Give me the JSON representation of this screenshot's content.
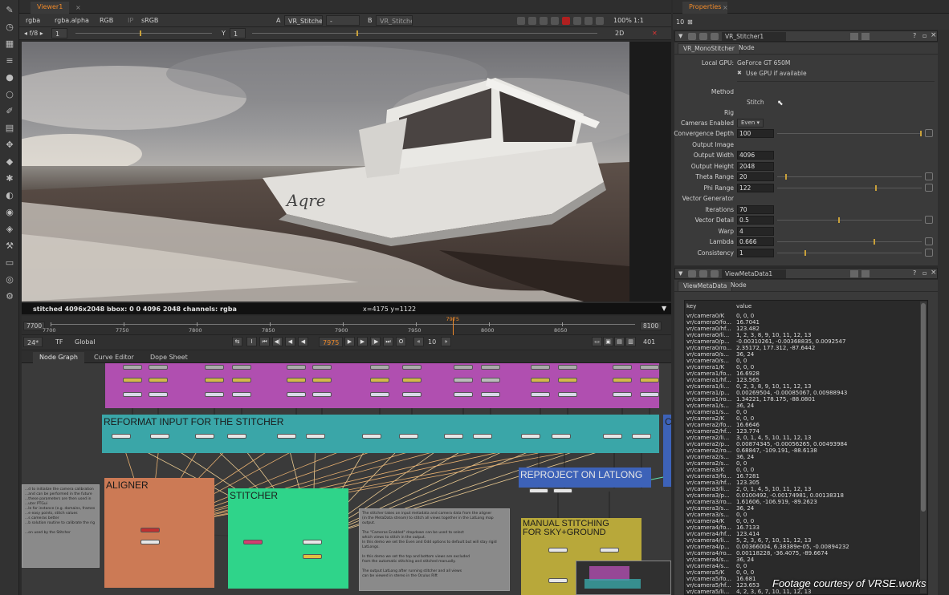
{
  "toolbar": {
    "tools": [
      "pen-icon",
      "clock-icon",
      "grid-icon",
      "lines-icon",
      "sphere-icon",
      "circle-icon",
      "brush-icon",
      "layers-icon",
      "move-icon",
      "cube-icon",
      "star-icon",
      "d-icon",
      "eye-icon",
      "tag-icon",
      "wrench-icon",
      "box-icon",
      "globe-icon",
      "settings-icon"
    ]
  },
  "viewer": {
    "tab_label": "Viewer1",
    "channels": "rgba",
    "alpha": "rgba.alpha",
    "colorspace": "RGB",
    "ip": "IP",
    "lut": "sRGB",
    "input_a_letter": "A",
    "input_a": "VR_Stitcher",
    "input_mid": "-",
    "input_b_letter": "B",
    "input_b": "VR_Stitcher",
    "zoom": "100%",
    "ratio": "1:1",
    "fstop": "f/8",
    "gain_value": "1",
    "gamma_label": "Y",
    "gamma_value": "1",
    "view_mode": "2D",
    "status_info": "stitched 4096x2048  bbox: 0 0 4096 2048 channels: rgba",
    "coords": "x=4175 y=1122"
  },
  "timeline": {
    "start": "7700",
    "end": "8100",
    "ticks": [
      "7700",
      "7750",
      "7800",
      "7850",
      "7900",
      "7950",
      "8000",
      "8050"
    ],
    "current": "7975",
    "current_fraction": 0.6875,
    "fps": "24*",
    "tf": "TF",
    "scope": "Global",
    "frame_field": "7975",
    "step": "10",
    "end_field": "401"
  },
  "node_graph_tabs": [
    "Node Graph",
    "Curve Editor",
    "Dope Sheet"
  ],
  "backdrops": {
    "reformat": "REFORMAT INPUT FOR THE STITCHER",
    "aligner": "ALIGNER",
    "stitcher": "STITCHER",
    "reproject": "REPROJECT ON LATLONG",
    "manual": "MANUAL STITCHING\nFOR SKY+GROUND",
    "edge": "C"
  },
  "sticky_left": "...d to initialize the camera calibration\n...and can be performed in the future\n...these parameters are then used in\n...uter PTGui\n...le for instance (e.g. domains, frames\n...e easy points, stitch values\n...s cameras better\n...b solution routine to calibrate the rig\n\n...on used by the Stitcher",
  "sticky_mid": "The stitcher takes an input metadata and camera data from the aligner\n(in the MetaData stream) to stitch all views together in the LatLong map output.\n\nThe \"Cameras Enabled\" dropdown can be used to select\nwhich views to stitch in the output.\nIn this demo we set the Even and Odd options to default but will stay rigid\nLatLongs.\n\nIn this demo we set the top and bottom views are excluded\nfrom the automatic stitching and stitched manually.\n\nThe output LatLong after running stitcher and all views\ncan be viewed in stereo in the Oculus Rift",
  "properties": {
    "tab_label": "Properties",
    "count": "10",
    "stitcher_panel": {
      "name": "VR_Stitcher1",
      "tabs": [
        "VR_MonoStitcher",
        "Node"
      ],
      "local_gpu_label": "Local GPU:",
      "local_gpu_value": "GeForce GT 650M",
      "use_gpu": "Use GPU if available",
      "method_label": "Method",
      "stitch_button": "Stitch",
      "rig_label": "Rig",
      "cameras_enabled_label": "Cameras Enabled",
      "cameras_enabled_value": "Even",
      "convergence_label": "Convergence Depth",
      "convergence_value": "100",
      "output_image_label": "Output Image",
      "output_width_label": "Output Width",
      "output_width_value": "4096",
      "output_height_label": "Output Height",
      "output_height_value": "2048",
      "theta_label": "Theta Range",
      "theta_value": "20",
      "phi_label": "Phi Range",
      "phi_value": "122",
      "vector_gen_label": "Vector Generator",
      "iterations_label": "Iterations",
      "iterations_value": "70",
      "vector_detail_label": "Vector Detail",
      "vector_detail_value": "0.5",
      "warp_label": "Warp",
      "warp_value": "4",
      "lambda_label": "Lambda",
      "lambda_value": "0.666",
      "consistency_label": "Consistency",
      "consistency_value": "1"
    },
    "meta_panel": {
      "name": "ViewMetaData1",
      "tabs": [
        "ViewMetaData",
        "Node"
      ],
      "col_key": "key",
      "col_value": "value",
      "rows": [
        [
          "vr/camera0/K",
          "0, 0, 0"
        ],
        [
          "vr/camera0/fo...",
          "16.7041"
        ],
        [
          "vr/camera0/hf...",
          "123.482"
        ],
        [
          "vr/camera0/li...",
          "1, 2, 3, 8, 9, 10, 11, 12, 13"
        ],
        [
          "vr/camera0/p...",
          "-0.00310261, -0.00368835, 0.0092547"
        ],
        [
          "vr/camera0/ro...",
          "2.35172, 177.312, -87.6442"
        ],
        [
          "vr/camera0/s...",
          "36, 24"
        ],
        [
          "vr/camera0/s...",
          "0, 0"
        ],
        [
          "vr/camera1/K",
          "0, 0, 0"
        ],
        [
          "vr/camera1/fo...",
          "16.6928"
        ],
        [
          "vr/camera1/hf...",
          "123.565"
        ],
        [
          "vr/camera1/li...",
          "0, 2, 3, 8, 9, 10, 11, 12, 13"
        ],
        [
          "vr/camera1/p...",
          "0.00269504, -0.00085067, 0.00988943"
        ],
        [
          "vr/camera1/ro...",
          "1.34221, 178.175, -88.0801"
        ],
        [
          "vr/camera1/s...",
          "36, 24"
        ],
        [
          "vr/camera1/s...",
          "0, 0"
        ],
        [
          "vr/camera2/K",
          "0, 0, 0"
        ],
        [
          "vr/camera2/fo...",
          "16.6646"
        ],
        [
          "vr/camera2/hf...",
          "123.774"
        ],
        [
          "vr/camera2/li...",
          "3, 0, 1, 4, 5, 10, 11, 12, 13"
        ],
        [
          "vr/camera2/p...",
          "0.00874345, -0.00056265, 0.00493984"
        ],
        [
          "vr/camera2/ro...",
          "0.68847, -109.191, -88.6138"
        ],
        [
          "vr/camera2/s...",
          "36, 24"
        ],
        [
          "vr/camera2/s...",
          "0, 0"
        ],
        [
          "vr/camera3/K",
          "0, 0, 0"
        ],
        [
          "vr/camera3/fo...",
          "16.7281"
        ],
        [
          "vr/camera3/hf...",
          "123.305"
        ],
        [
          "vr/camera3/li...",
          "2, 0, 1, 4, 5, 10, 11, 12, 13"
        ],
        [
          "vr/camera3/p...",
          "0.0100492, -0.00174981, 0.00138318"
        ],
        [
          "vr/camera3/ro...",
          "1.61606, -106.919, -89.2623"
        ],
        [
          "vr/camera3/s...",
          "36, 24"
        ],
        [
          "vr/camera3/s...",
          "0, 0"
        ],
        [
          "vr/camera4/K",
          "0, 0, 0"
        ],
        [
          "vr/camera4/fo...",
          "16.7133"
        ],
        [
          "vr/camera4/hf...",
          "123.414"
        ],
        [
          "vr/camera4/li...",
          "5, 2, 3, 6, 7, 10, 11, 12, 13"
        ],
        [
          "vr/camera4/p...",
          "0.00366004, 6.38389e-05, -0.00894232"
        ],
        [
          "vr/camera4/ro...",
          "0.00118228, -36.4075, -89.6674"
        ],
        [
          "vr/camera4/s...",
          "36, 24"
        ],
        [
          "vr/camera4/s...",
          "0, 0"
        ],
        [
          "vr/camera5/K",
          "0, 0, 0"
        ],
        [
          "vr/camera5/fo...",
          "16.681"
        ],
        [
          "vr/camera5/hf...",
          "123.653"
        ],
        [
          "vr/camera5/li...",
          "4, 2, 3, 6, 7, 10, 11, 12, 13"
        ]
      ]
    }
  },
  "credit": "Footage courtesy of VRSE.works",
  "colors": {
    "accent_orange": "#f08a2a",
    "backdrop_purple": "#b04fb0",
    "backdrop_teal": "#3aa6a8",
    "backdrop_aligner": "#cc7a55",
    "backdrop_stitcher": "#2fd48a",
    "backdrop_reproject": "#3d62b8",
    "backdrop_manual": "#b8a83a"
  }
}
